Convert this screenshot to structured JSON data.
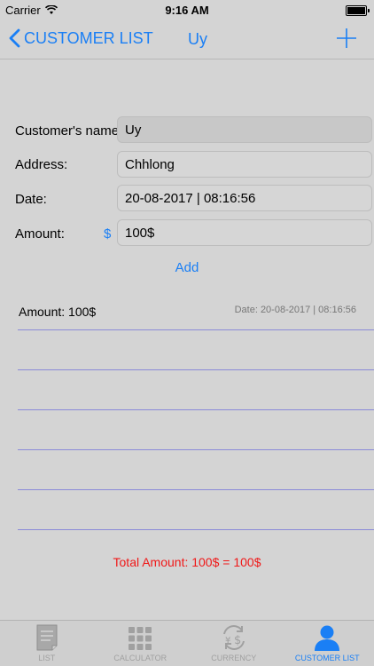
{
  "status": {
    "carrier": "Carrier",
    "time": "9:16 AM"
  },
  "nav": {
    "back_label": "CUSTOMER LIST",
    "title": "Uy"
  },
  "form": {
    "name_label": "Customer's name:",
    "name_value": "Uy",
    "address_label": "Address:",
    "address_value": "Chhlong",
    "date_label": "Date:",
    "date_value": "20-08-2017 | 08:16:56",
    "amount_label": "Amount:",
    "currency_symbol": "$",
    "amount_value": "100$",
    "add_label": "Add"
  },
  "entries": [
    {
      "amount": "Amount: 100$",
      "date": "Date: 20-08-2017 | 08:16:56"
    },
    {
      "amount": "",
      "date": ""
    },
    {
      "amount": "",
      "date": ""
    },
    {
      "amount": "",
      "date": ""
    },
    {
      "amount": "",
      "date": ""
    },
    {
      "amount": "",
      "date": ""
    }
  ],
  "total": "Total Amount: 100$ = 100$",
  "tabs": [
    {
      "label": "LIST",
      "icon": "list-document-icon"
    },
    {
      "label": "CALCULATOR",
      "icon": "calculator-icon"
    },
    {
      "label": "CURRENCY",
      "icon": "currency-exchange-icon"
    },
    {
      "label": "CUSTOMER LIST",
      "icon": "person-icon",
      "active": true
    }
  ],
  "colors": {
    "accent": "#1a7ff5",
    "total": "#f01818",
    "row_line": "#8a8ad8"
  }
}
